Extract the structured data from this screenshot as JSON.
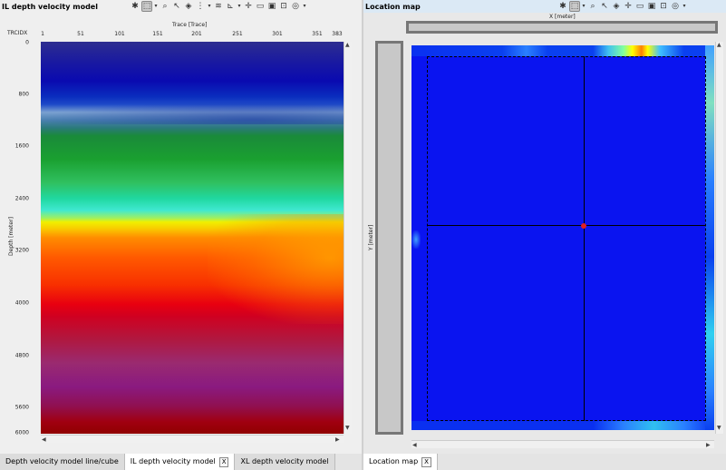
{
  "left_panel": {
    "title": "IL depth velocity model",
    "toolbar": [
      "gear-icon",
      "select-icon",
      "zoom-icon",
      "pick-icon",
      "layers-icon",
      "grid-icon",
      "wiggle-icon",
      "axes-icon",
      "cross-icon",
      "comment-icon",
      "image-icon",
      "snapshot-icon",
      "compass-icon"
    ],
    "corner_label": "TRCIDX",
    "x_axis_label": "Trace [Trace]",
    "x_ticks": [
      "1",
      "51",
      "101",
      "151",
      "201",
      "251",
      "301",
      "351",
      "383"
    ],
    "y_axis_label": "Depth [meter]",
    "y_ticks": [
      "0",
      "800",
      "1600",
      "2400",
      "3200",
      "4000",
      "4800",
      "5600",
      "6000"
    ]
  },
  "right_panel": {
    "title": "Location map",
    "toolbar": [
      "gear-icon",
      "select-icon",
      "zoom-icon",
      "pick-icon",
      "layers-icon",
      "cross-icon",
      "comment-icon",
      "image-icon",
      "snapshot-icon",
      "compass-icon"
    ],
    "x_axis_label": "X [meter]",
    "y_axis_label": "Y [meter]"
  },
  "tabs_left": [
    {
      "label": "Depth velocity model line/cube",
      "active": false,
      "closable": false
    },
    {
      "label": "IL depth velocity model",
      "active": true,
      "closable": true
    },
    {
      "label": "XL depth velocity model",
      "active": false,
      "closable": false
    }
  ],
  "tabs_right": [
    {
      "label": "Location map",
      "active": true,
      "closable": true
    }
  ],
  "close_label": "X",
  "colors": {
    "accent_titlebar": "#dbe9f5",
    "marker": "#e02020"
  }
}
